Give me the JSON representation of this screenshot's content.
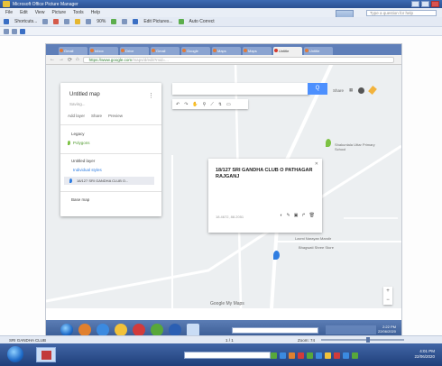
{
  "window": {
    "title": "Microsoft Office Picture Manager",
    "menu": [
      "File",
      "Edit",
      "View",
      "Picture",
      "Tools",
      "Help"
    ],
    "help_placeholder": "Type a question for help",
    "toolbar": {
      "shortcuts_label": "Shortcuts...",
      "zoom_value": "90%",
      "edit_pictures_label": "Edit Pictures...",
      "auto_correct_label": "Auto Correct"
    }
  },
  "browser": {
    "tabs": [
      {
        "label": "Gmail",
        "active": false
      },
      {
        "label": "Inbox",
        "active": false
      },
      {
        "label": "Drive",
        "active": false
      },
      {
        "label": "Gmail",
        "active": false
      },
      {
        "label": "Google",
        "active": false
      },
      {
        "label": "Maps",
        "active": false
      },
      {
        "label": "Maps",
        "active": false
      },
      {
        "label": "Untitle",
        "active": true
      },
      {
        "label": "Untitle",
        "active": false
      }
    ],
    "url_host": "https://www.google.com",
    "url_rest": "/maps/d/edit?mid=..."
  },
  "map": {
    "panel": {
      "title": "Untitled map",
      "subtitle": "Saving...",
      "actions": [
        "Add layer",
        "Share",
        "Preview"
      ],
      "base_layer": "Legacy",
      "base_layer_sub": "Polygons",
      "layer_title": "Untitled layer",
      "layer_sub": "Individual styles",
      "selected_item": "18/127 SRI GANDHA CLUB O...",
      "base_map": "Base map"
    },
    "search_button": "Q",
    "share_label": "Share",
    "infobox": {
      "title": "18/127 SRI GANDHA CLUB O PATHAGAR RAJGANJ",
      "footer": "18.4672, 88.2051"
    },
    "labels": [
      {
        "text": "Shakuntala Uttar Primary School",
        "id": "school"
      },
      {
        "text": "Laxmi Narayan Mandir",
        "id": "mandir"
      },
      {
        "text": "Bhagwati Shree Store",
        "id": "store"
      }
    ],
    "google_logo": "Google My Maps",
    "zoom": {
      "plus": "+",
      "minus": "−"
    },
    "colors": {
      "pin_blue": "#2f7de1",
      "pin_green": "#7cc243",
      "accent": "#4d90fe"
    }
  },
  "inner_taskbar": {
    "clock_time": "2:22 PM",
    "clock_date": "22/06/2020"
  },
  "statusbar": {
    "file_name": "SRI GANDHA CLUB",
    "page_info": "1 / 1",
    "zoom_label": "Zoom: 74"
  },
  "outer_taskbar": {
    "clock_time": "4:01 PM",
    "clock_date": "22/06/2020"
  }
}
